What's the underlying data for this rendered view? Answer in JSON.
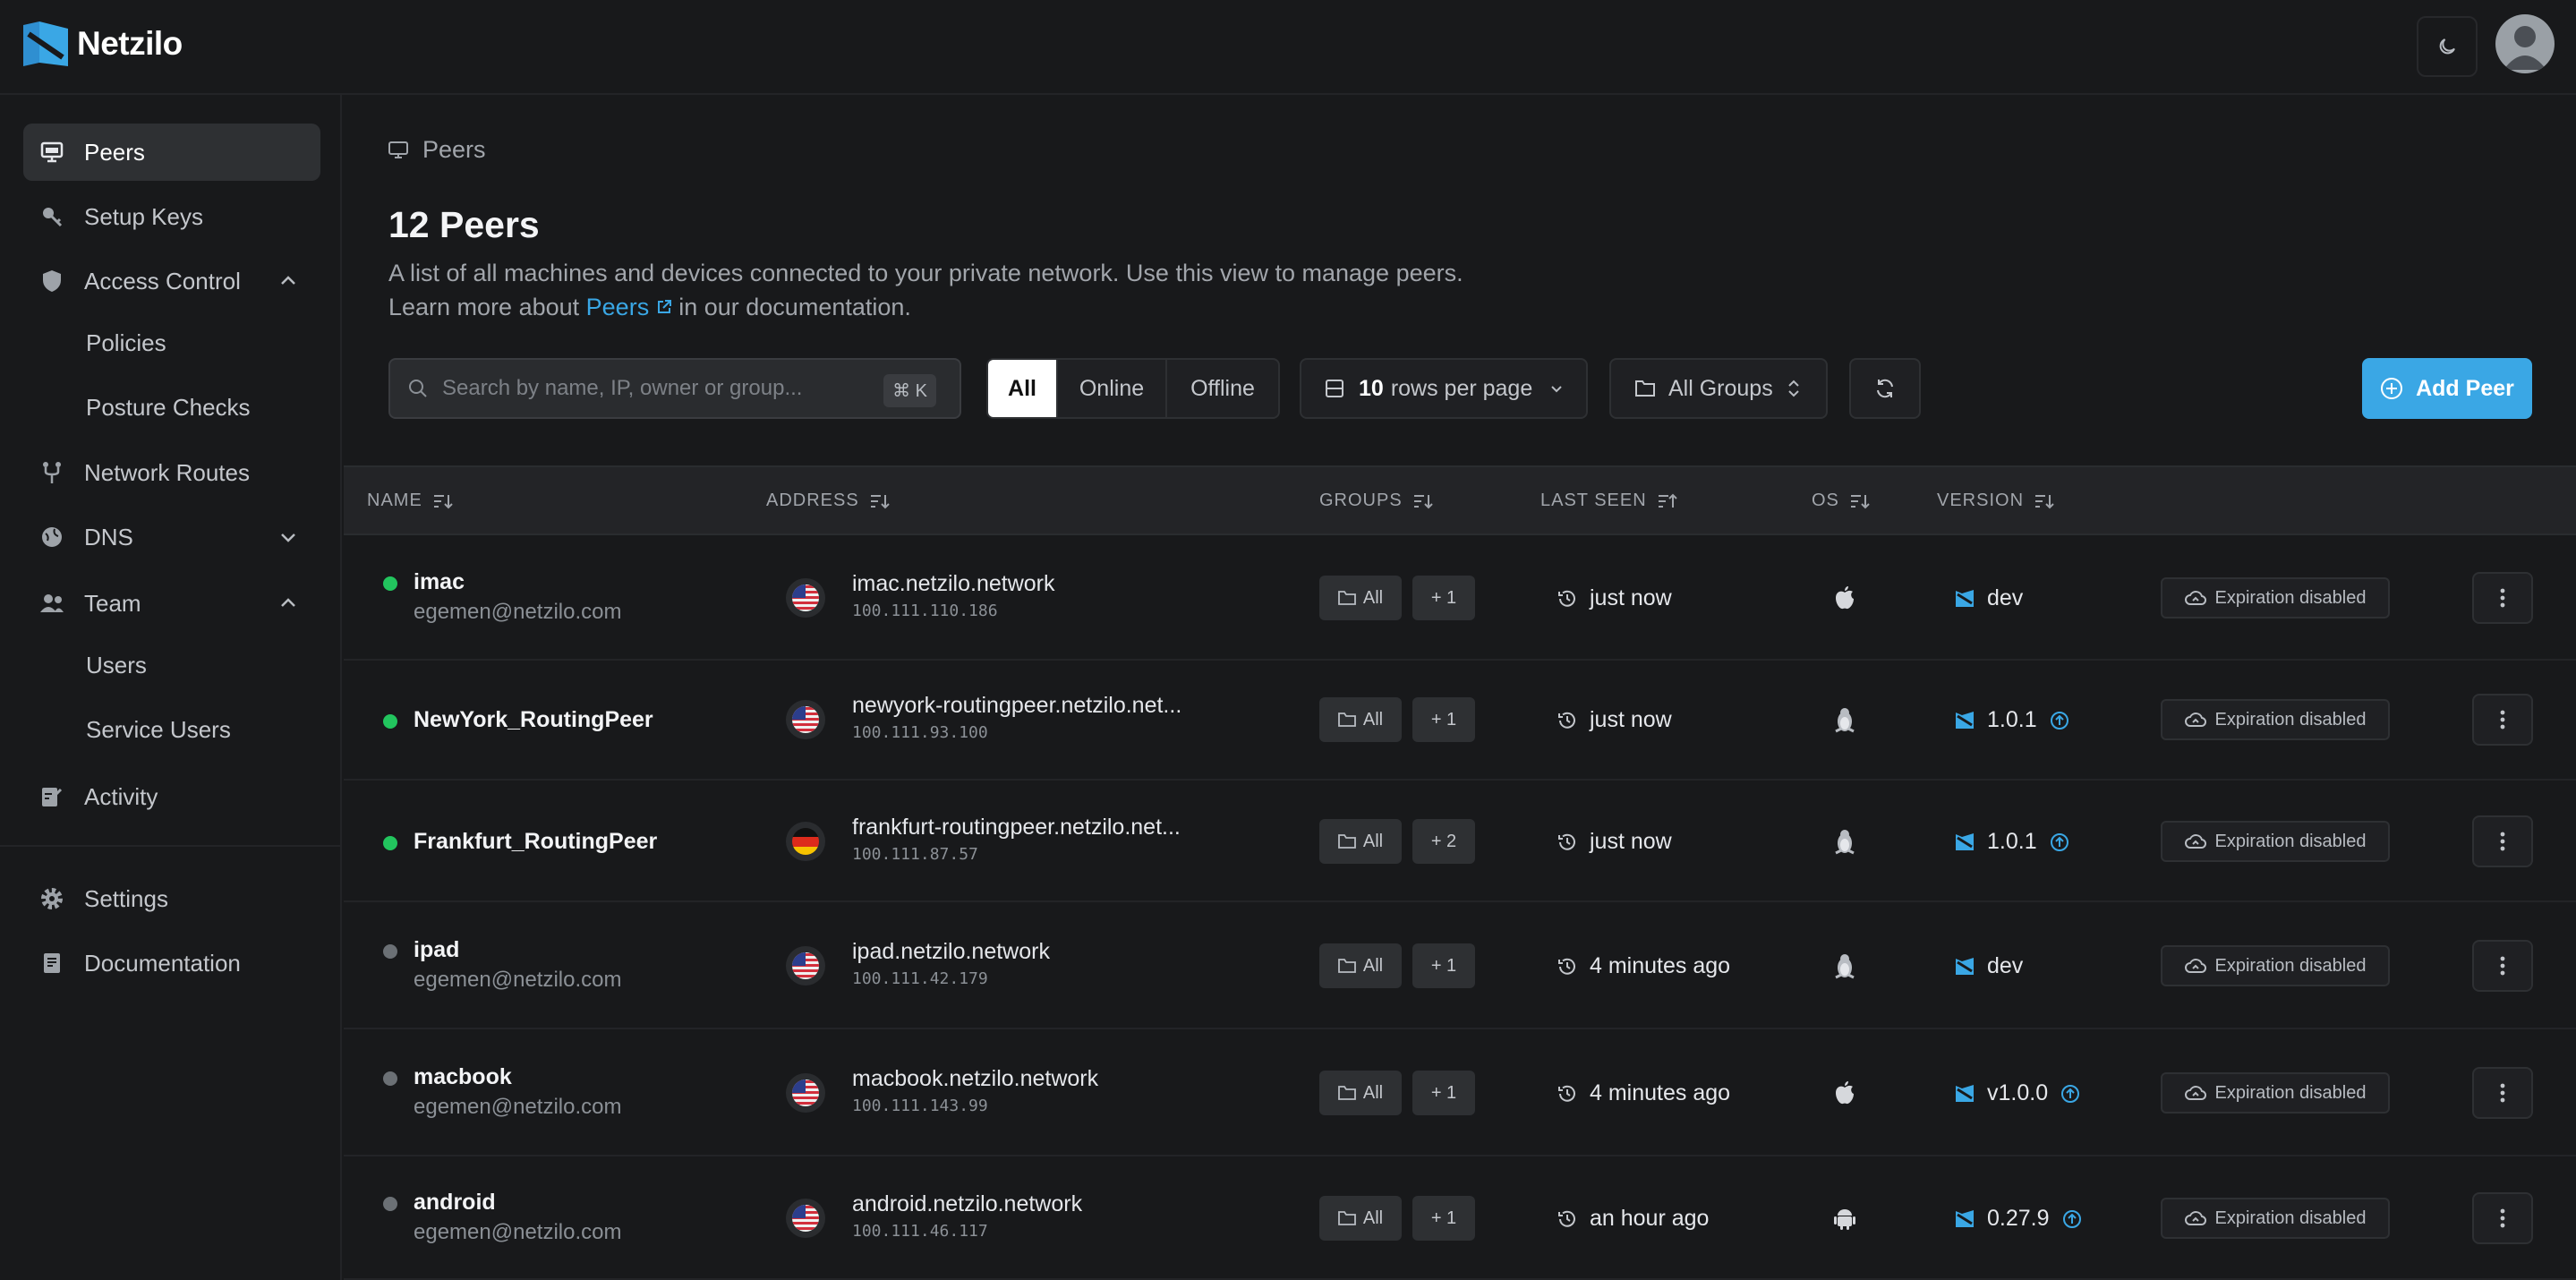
{
  "app": {
    "name": "Netzilo"
  },
  "sidebar": {
    "items": [
      {
        "label": "Peers"
      },
      {
        "label": "Setup Keys"
      },
      {
        "label": "Access Control",
        "children": [
          {
            "label": "Policies"
          },
          {
            "label": "Posture Checks"
          }
        ]
      },
      {
        "label": "Network Routes"
      },
      {
        "label": "DNS"
      },
      {
        "label": "Team",
        "children": [
          {
            "label": "Users"
          },
          {
            "label": "Service Users"
          }
        ]
      },
      {
        "label": "Activity"
      },
      {
        "label": "Settings"
      },
      {
        "label": "Documentation"
      }
    ]
  },
  "page": {
    "breadcrumb": "Peers",
    "title": "12 Peers",
    "description": "A list of all machines and devices connected to your private network. Use this view to manage peers.",
    "learn_prefix": "Learn more about",
    "learn_link": "Peers",
    "learn_suffix": "in our documentation."
  },
  "toolbar": {
    "search_placeholder": "Search by name, IP, owner or group...",
    "search_shortcut": "⌘ K",
    "filters": [
      "All",
      "Online",
      "Offline"
    ],
    "selected_filter": "All",
    "rows_value": "10",
    "rows_label": "rows per page",
    "groups_label": "All Groups",
    "add_label": "Add Peer"
  },
  "table": {
    "headers": {
      "name": "NAME",
      "address": "ADDRESS",
      "groups": "GROUPS",
      "last_seen": "LAST SEEN",
      "os": "OS",
      "version": "VERSION"
    },
    "rows": [
      {
        "name": "imac",
        "owner": "egemen@netzilo.com",
        "online": true,
        "country": "US",
        "host": "imac.netzilo.network",
        "ip": "100.111.110.186",
        "group": "All",
        "extra": "+ 1",
        "seen": "just now",
        "os": "apple",
        "version": "dev",
        "update": false,
        "expiration": "Expiration disabled"
      },
      {
        "name": "NewYork_RoutingPeer",
        "owner": "",
        "online": true,
        "country": "US",
        "host": "newyork-routingpeer.netzilo.net...",
        "ip": "100.111.93.100",
        "group": "All",
        "extra": "+ 1",
        "seen": "just now",
        "os": "linux",
        "version": "1.0.1",
        "update": true,
        "expiration": "Expiration disabled"
      },
      {
        "name": "Frankfurt_RoutingPeer",
        "owner": "",
        "online": true,
        "country": "DE",
        "host": "frankfurt-routingpeer.netzilo.net...",
        "ip": "100.111.87.57",
        "group": "All",
        "extra": "+ 2",
        "seen": "just now",
        "os": "linux",
        "version": "1.0.1",
        "update": true,
        "expiration": "Expiration disabled"
      },
      {
        "name": "ipad",
        "owner": "egemen@netzilo.com",
        "online": false,
        "country": "US",
        "host": "ipad.netzilo.network",
        "ip": "100.111.42.179",
        "group": "All",
        "extra": "+ 1",
        "seen": "4 minutes ago",
        "os": "linux",
        "version": "dev",
        "update": false,
        "expiration": "Expiration disabled"
      },
      {
        "name": "macbook",
        "owner": "egemen@netzilo.com",
        "online": false,
        "country": "US",
        "host": "macbook.netzilo.network",
        "ip": "100.111.143.99",
        "group": "All",
        "extra": "+ 1",
        "seen": "4 minutes ago",
        "os": "apple",
        "version": "v1.0.0",
        "update": true,
        "expiration": "Expiration disabled"
      },
      {
        "name": "android",
        "owner": "egemen@netzilo.com",
        "online": false,
        "country": "US",
        "host": "android.netzilo.network",
        "ip": "100.111.46.117",
        "group": "All",
        "extra": "+ 1",
        "seen": "an hour ago",
        "os": "android",
        "version": "0.27.9",
        "update": true,
        "expiration": "Expiration disabled"
      }
    ]
  },
  "colors": {
    "accent": "#3aa7e5",
    "online": "#22c55e",
    "offline": "#6b7075"
  }
}
